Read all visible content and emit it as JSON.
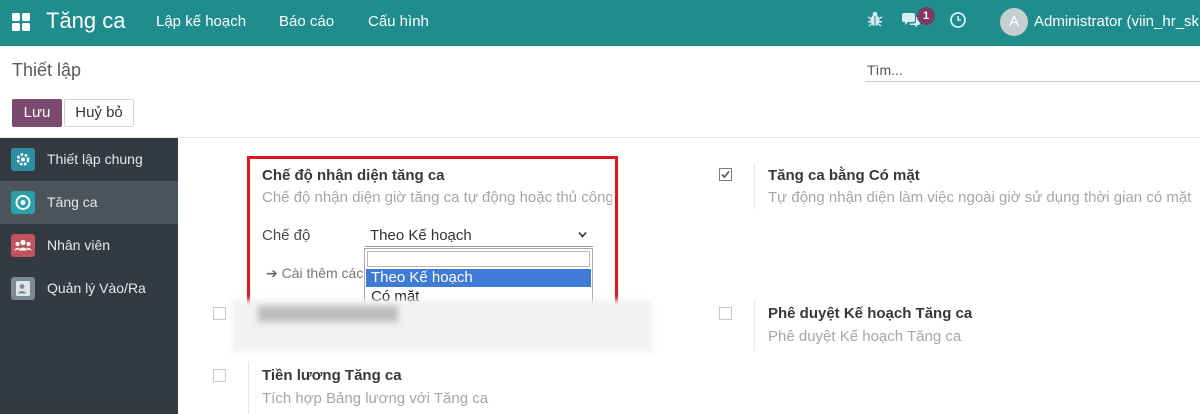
{
  "navbar": {
    "app_title": "Tăng ca",
    "menu": [
      "Lập kế hoạch",
      "Báo cáo",
      "Cấu hình"
    ],
    "message_count": "1",
    "avatar_letter": "A",
    "user_name": "Administrator (viin_hr_sk"
  },
  "control_panel": {
    "breadcrumb": "Thiết lập",
    "search_placeholder": "Tìm...",
    "save_label": "Lưu",
    "cancel_label": "Huỷ bỏ"
  },
  "sidebar": {
    "items": [
      {
        "label": "Thiết lập chung",
        "icon": "settings-icon",
        "color": "#2d8fa3"
      },
      {
        "label": "Tăng ca",
        "icon": "overtime-icon",
        "color": "#2aa0a8",
        "active": true
      },
      {
        "label": "Nhân viên",
        "icon": "employees-icon",
        "color": "#c2545f"
      },
      {
        "label": "Quản lý Vào/Ra",
        "icon": "attendance-icon",
        "color": "#7c8a96"
      }
    ]
  },
  "settings": {
    "mode": {
      "title": "Chế độ nhận diện tăng ca",
      "description": "Chế độ nhận diện giờ tăng ca tự động hoặc thủ công",
      "field_label": "Chế độ",
      "selected": "Theo Kế hoạch",
      "options": [
        "Theo Kế hoạch",
        "Có mặt"
      ],
      "more_link": "Cài thêm các"
    },
    "attendance": {
      "title": "Tăng ca bằng Có mặt",
      "description": "Tự động nhận diện làm việc ngoài giờ sử dụng thời gian có mặt",
      "checked": true
    },
    "approval": {
      "title": "Phê duyệt Kế hoạch Tăng ca",
      "description": "Phê duyệt Kế hoạch Tăng ca",
      "checked": false
    },
    "payroll": {
      "title": "Tiền lương Tăng ca",
      "description": "Tích hợp Bảng lương với Tăng ca",
      "checked": false
    }
  },
  "colors": {
    "navbar": "#1f8c8d",
    "primary_button": "#7c4a6f",
    "sidebar": "#333a41",
    "highlight": "#e2151c",
    "dropdown_hover": "#3d7bd6"
  }
}
